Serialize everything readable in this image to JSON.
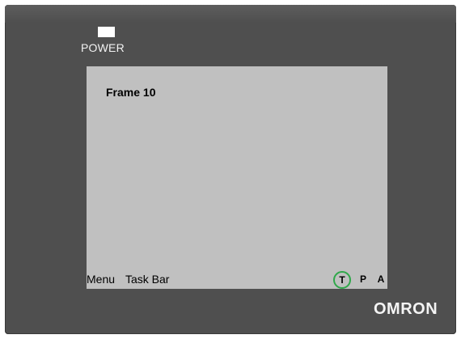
{
  "device": {
    "power_label": "POWER",
    "brand": "OMRON",
    "colors": {
      "bezel": "#4f4f4f",
      "screen": "#c0c0c0",
      "power_led": "#ffffff",
      "active_mode_ring": "#2fa84a"
    }
  },
  "screen": {
    "frame_title": "Frame 10",
    "taskbar": {
      "menu_label": "Menu",
      "taskbar_label": "Task Bar",
      "modes": [
        {
          "label": "T",
          "active": true
        },
        {
          "label": "P",
          "active": false
        },
        {
          "label": "A",
          "active": false
        }
      ]
    }
  }
}
